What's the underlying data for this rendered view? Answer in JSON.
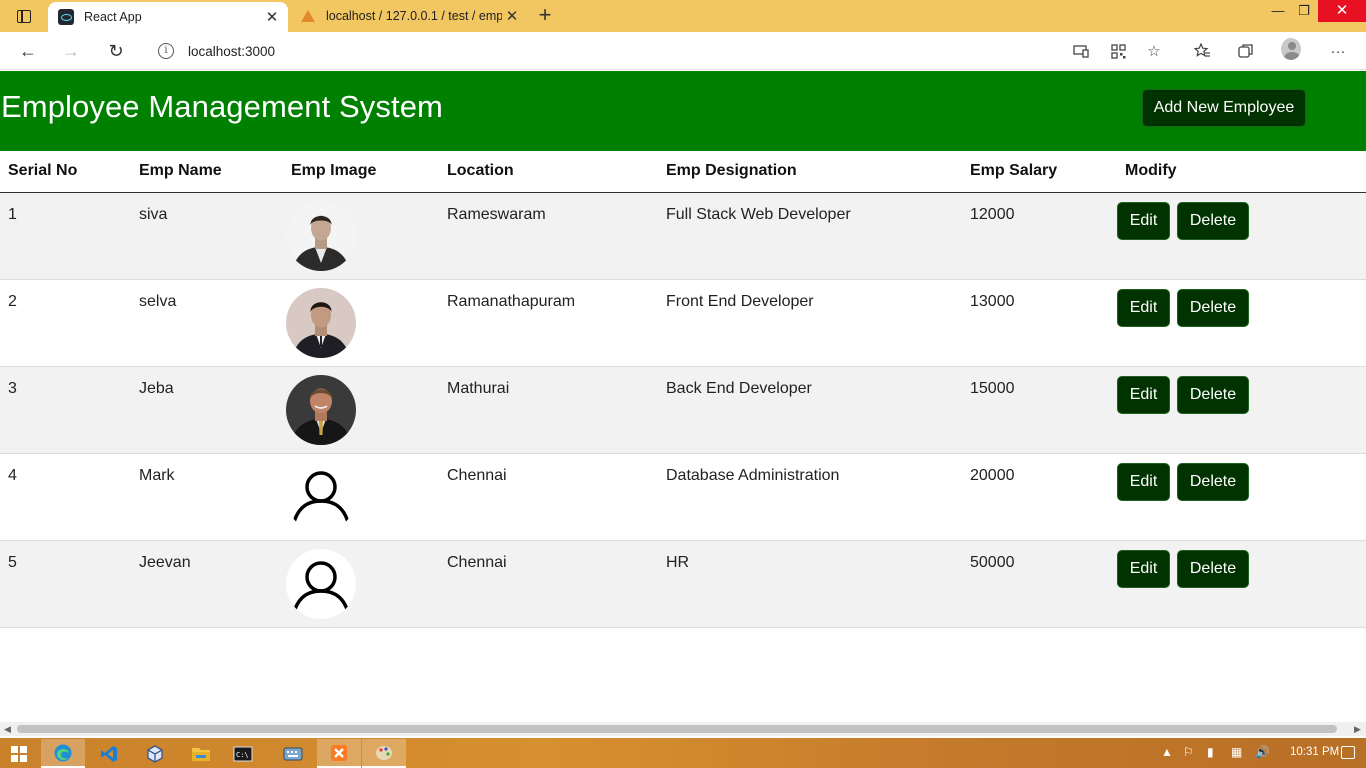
{
  "browser": {
    "tabs": [
      {
        "title": "React App",
        "active": true,
        "favicon": "react-logo-icon"
      },
      {
        "title": "localhost / 127.0.0.1 / test / emp",
        "active": false,
        "favicon": "phpmyadmin-logo-icon"
      }
    ],
    "url": "localhost:3000",
    "window_controls": {
      "minimize": "—",
      "maximize": "❐",
      "close": "✕"
    }
  },
  "app": {
    "title": "Employee Management System",
    "add_button_label": "Add New Employee",
    "header_color": "#008000",
    "button_color": "#003300"
  },
  "table": {
    "columns": [
      "Serial No",
      "Emp Name",
      "Emp Image",
      "Location",
      "Emp Designation",
      "Emp Salary",
      "Modify"
    ],
    "rows": [
      {
        "serial": "1",
        "name": "siva",
        "image": "photo-man-suit-light",
        "location": "Rameswaram",
        "designation": "Full Stack Web Developer",
        "salary": "12000"
      },
      {
        "serial": "2",
        "name": "selva",
        "image": "photo-man-suit-dark",
        "location": "Ramanathapuram",
        "designation": "Front End Developer",
        "salary": "13000"
      },
      {
        "serial": "3",
        "name": "Jeba",
        "image": "photo-man-smiling",
        "location": "Mathurai",
        "designation": "Back End Developer",
        "salary": "15000"
      },
      {
        "serial": "4",
        "name": "Mark",
        "image": "user-placeholder-icon",
        "location": "Chennai",
        "designation": "Database Administration",
        "salary": "20000"
      },
      {
        "serial": "5",
        "name": "Jeevan",
        "image": "user-placeholder-icon",
        "location": "Chennai",
        "designation": "HR",
        "salary": "50000"
      }
    ],
    "edit_label": "Edit",
    "delete_label": "Delete"
  },
  "taskbar": {
    "clock": "10:31 PM"
  }
}
